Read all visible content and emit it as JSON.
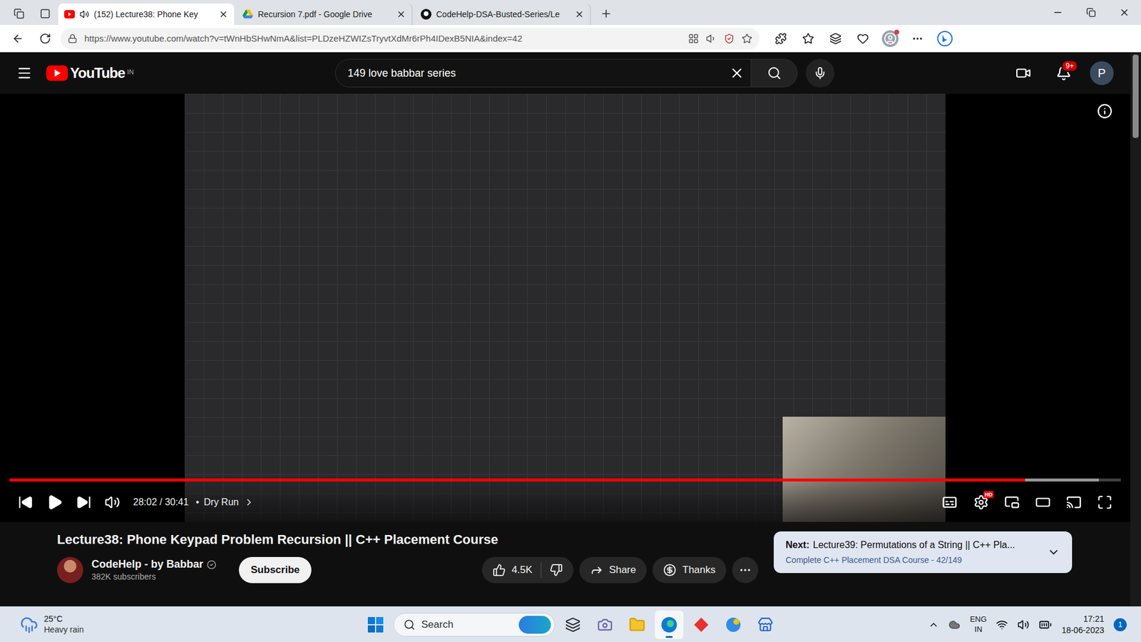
{
  "browser": {
    "tabs": [
      {
        "label": "(152) Lecture38: Phone Key",
        "selected": true,
        "audible": true
      },
      {
        "label": "Recursion 7.pdf - Google Drive",
        "selected": false,
        "audible": false
      },
      {
        "label": "CodeHelp-DSA-Busted-Series/Le",
        "selected": false,
        "audible": false
      }
    ],
    "url": "https://www.youtube.com/watch?v=tWnHbSHwNmA&list=PLDzeHZWIZsTryvtXdMr6rPh4IDexB5NIA&index=42"
  },
  "youtube": {
    "logo": "YouTube",
    "region": "IN",
    "search": "149 love babbar series",
    "notifications": "9+",
    "avatar": "P"
  },
  "player": {
    "time": "28:02 / 30:41",
    "separator": "•",
    "chapter": "Dry Run",
    "progress": 0.914,
    "buffered": 0.98,
    "playing": false,
    "quality": "HD"
  },
  "video": {
    "title": "Lecture38: Phone Keypad Problem Recursion || C++ Placement Course",
    "channel": "CodeHelp - by Babbar",
    "verified": true,
    "subscribers": "382K subscribers",
    "subscribe": "Subscribe",
    "likes": "4.5K",
    "share": "Share",
    "thanks": "Thanks"
  },
  "next": {
    "label": "Next:",
    "title": "Lecture39: Permutations of a String || C++ Pla...",
    "playlist": "Complete C++ Placement DSA Course - 42/149"
  },
  "taskbar": {
    "weather": {
      "temp": "25°C",
      "condition": "Heavy rain"
    },
    "search": "Search",
    "apps": [
      {
        "running": false
      },
      {
        "running": false
      },
      {
        "running": false
      },
      {
        "running": true
      },
      {
        "running": false
      },
      {
        "running": false
      },
      {
        "running": false
      }
    ],
    "language": [
      "ENG",
      "IN"
    ],
    "time": "17:21",
    "date": "18-06-2023",
    "badge": "1"
  }
}
